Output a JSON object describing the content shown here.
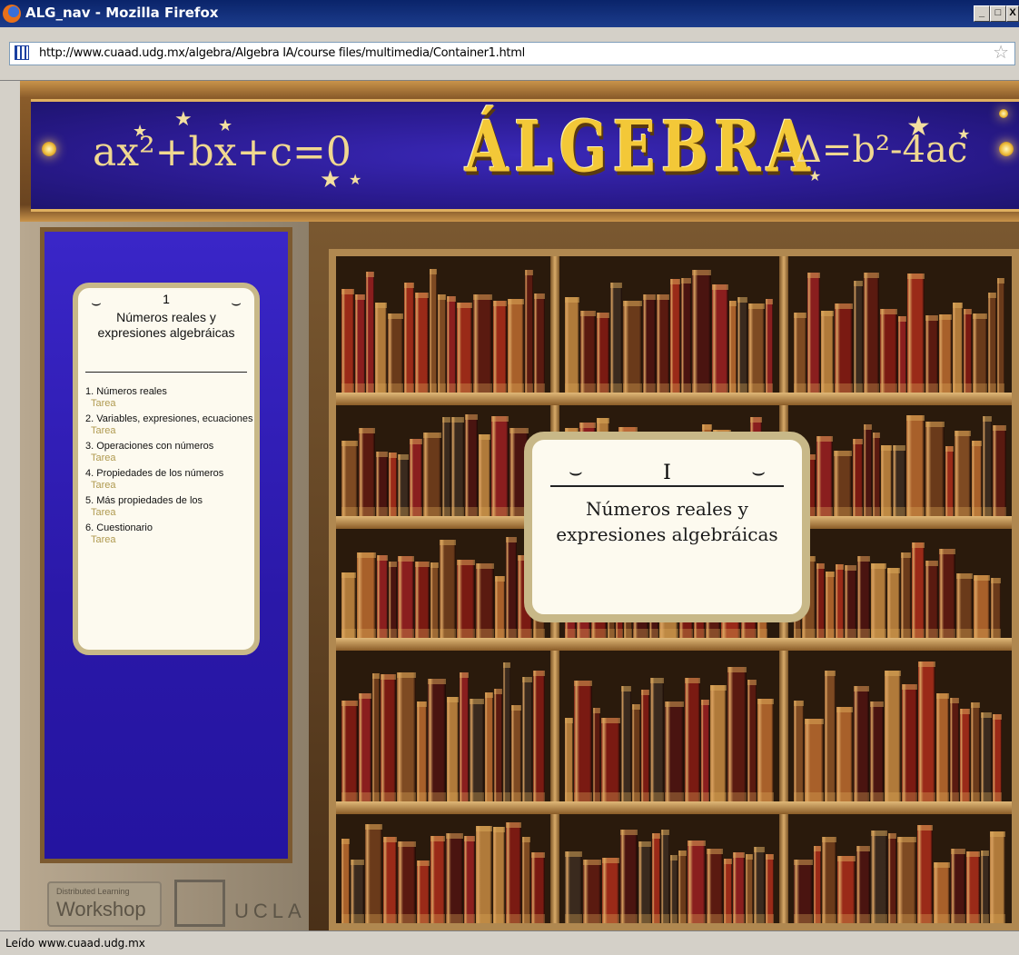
{
  "window": {
    "title": "ALG_nav - Mozilla Firefox",
    "minimize_label": "_",
    "maximize_label": "□",
    "close_label": "X"
  },
  "address_bar": {
    "url": "http://www.cuaad.udg.mx/algebra/Algebra IA/course files/multimedia/Container1.html",
    "bookmark_label": "☆"
  },
  "banner": {
    "formula_left": "ax²+bx+c=0",
    "title": "ÁLGEBRA",
    "formula_right": "Δ=b²-4ac"
  },
  "menu_card": {
    "ornament_left": "⌣",
    "number": "1",
    "ornament_right": "⌣",
    "title_line1": "Números reales y",
    "title_line2": "expresiones algebráicas",
    "items": [
      {
        "label": "1. Números reales",
        "tarea": "Tarea"
      },
      {
        "label": "2. Variables, expresiones, ecuaciones",
        "tarea": "Tarea"
      },
      {
        "label": "3. Operaciones con números",
        "tarea": "Tarea"
      },
      {
        "label": "4. Propiedades de los números",
        "tarea": "Tarea"
      },
      {
        "label": "5. Más propiedades de los",
        "tarea": "Tarea"
      },
      {
        "label": "6. Cuestionario",
        "tarea": "Tarea"
      }
    ]
  },
  "center_card": {
    "number": "I",
    "title_line1": "Números reales y",
    "title_line2": "expresiones algebráicas"
  },
  "logos": {
    "dlw_small": "Distributed Learning",
    "dlw_big": "Workshop",
    "ucla": "UCLA"
  },
  "status_bar": {
    "text": "Leído www.cuaad.udg.mx"
  },
  "colors": {
    "banner_blue": "#2a1a8e",
    "title_gold": "#f3c838",
    "tarea_gold": "#b09a50",
    "card_bg": "#fdfaef"
  }
}
